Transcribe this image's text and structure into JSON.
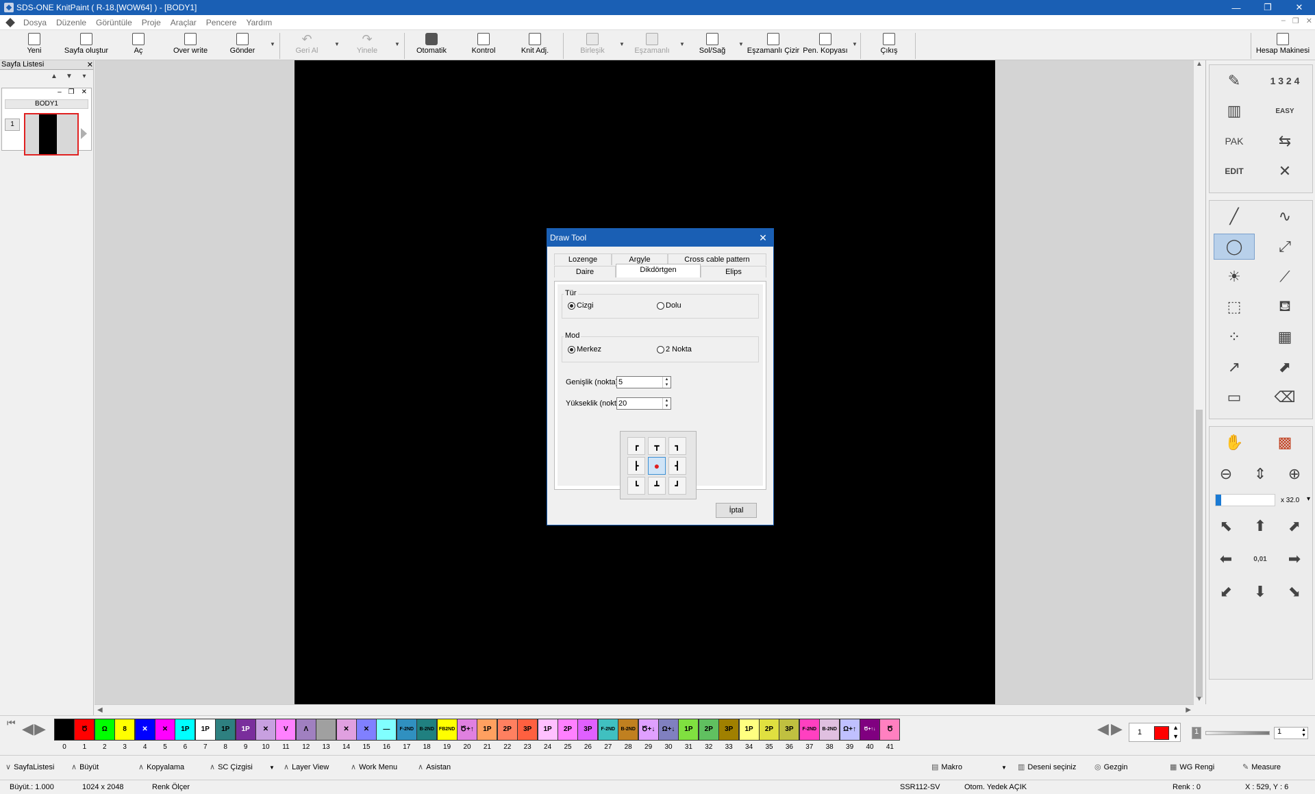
{
  "window": {
    "title": "SDS-ONE KnitPaint ( R-18.[WOW64] ) - [BODY1]",
    "minimize": "—",
    "restore": "❐",
    "close": "✕"
  },
  "menu": [
    "Dosya",
    "Düzenle",
    "Görüntüle",
    "Proje",
    "Araçlar",
    "Pencere",
    "Yardım"
  ],
  "mdi_controls": [
    "–",
    "❐",
    "✕"
  ],
  "toolbar": {
    "new": "Yeni",
    "create_page": "Sayfa oluştur",
    "open": "Aç",
    "overwrite": "Over write",
    "send": "Gönder",
    "undo": "Geri Al",
    "redo": "Yinele",
    "auto": "Otomatik",
    "control": "Kontrol",
    "knit_adj": "Knit Adj.",
    "merge": "Birleşik",
    "simultaneous": "Eşzamanlı",
    "left_right": "Sol/Sağ",
    "sync_draw": "Eşzamanlı Çizir",
    "pen_copy": "Pen. Kopyası",
    "exit": "Çıkış",
    "calculator": "Hesap Makinesi"
  },
  "page_list": {
    "title": "Sayfa Listesi",
    "close": "✕",
    "page_name": "BODY1",
    "page_number": "1"
  },
  "right_panel": {
    "zoom": "x 32.0",
    "easy": "EASY",
    "pak": "PAK",
    "edit": "EDIT",
    "step": "0,01",
    "numbers": "1 3 2 4"
  },
  "dialog": {
    "title": "Draw Tool",
    "close": "✕",
    "tabs_row1": [
      "Lozenge",
      "Argyle",
      "Cross cable pattern"
    ],
    "tabs_row2": [
      "Daire",
      "Dikdörtgen",
      "Elips"
    ],
    "active_tab": "Dikdörtgen",
    "type_group": {
      "label": "Tür",
      "options": [
        "Cizgi",
        "Dolu"
      ],
      "selected": "Cizgi"
    },
    "mode_group": {
      "label": "Mod",
      "options": [
        "Merkez",
        "2 Nokta"
      ],
      "selected": "Merkez"
    },
    "width_label": "Genişlik (nokta)",
    "width_value": "5",
    "height_label": "Yükseklik (nokta)",
    "height_value": "20",
    "anchor_selected": "center",
    "cancel": "İptal"
  },
  "palette": [
    {
      "n": "0",
      "c": "#000000",
      "t": ""
    },
    {
      "n": "1",
      "c": "#ff0000",
      "t": "Ծ"
    },
    {
      "n": "2",
      "c": "#00ff00",
      "t": "Ω"
    },
    {
      "n": "3",
      "c": "#ffff00",
      "t": "8"
    },
    {
      "n": "4",
      "c": "#0000ff",
      "t": "✕"
    },
    {
      "n": "5",
      "c": "#ff00ff",
      "t": "✕"
    },
    {
      "n": "6",
      "c": "#00ffff",
      "t": "1P"
    },
    {
      "n": "7",
      "c": "#ffffff",
      "t": "1P"
    },
    {
      "n": "8",
      "c": "#2e8080",
      "t": "1P"
    },
    {
      "n": "9",
      "c": "#7a2e9c",
      "t": "1P"
    },
    {
      "n": "10",
      "c": "#c8a0e0",
      "t": "✕"
    },
    {
      "n": "11",
      "c": "#ff80ff",
      "t": "V"
    },
    {
      "n": "12",
      "c": "#a080c0",
      "t": "Λ"
    },
    {
      "n": "13",
      "c": "#a0a0a0",
      "t": ""
    },
    {
      "n": "14",
      "c": "#e0a0e0",
      "t": "✕"
    },
    {
      "n": "15",
      "c": "#8080ff",
      "t": "✕"
    },
    {
      "n": "16",
      "c": "#80ffff",
      "t": "—"
    },
    {
      "n": "17",
      "c": "#3090c0",
      "t": "F-2ND"
    },
    {
      "n": "18",
      "c": "#208080",
      "t": "B-2ND"
    },
    {
      "n": "19",
      "c": "#ffff00",
      "t": "FB2ND"
    },
    {
      "n": "20",
      "c": "#e080e0",
      "t": "Ծ+↑"
    },
    {
      "n": "21",
      "c": "#ffa060",
      "t": "1P"
    },
    {
      "n": "22",
      "c": "#ff8060",
      "t": "2P"
    },
    {
      "n": "23",
      "c": "#ff6040",
      "t": "3P"
    },
    {
      "n": "24",
      "c": "#ffc0ff",
      "t": "1P"
    },
    {
      "n": "25",
      "c": "#ff80ff",
      "t": "2P"
    },
    {
      "n": "26",
      "c": "#e060ff",
      "t": "3P"
    },
    {
      "n": "27",
      "c": "#40c0c0",
      "t": "F-2ND"
    },
    {
      "n": "28",
      "c": "#c08020",
      "t": "B-2ND"
    },
    {
      "n": "29",
      "c": "#e0a0ff",
      "t": "Ծ+↓"
    },
    {
      "n": "30",
      "c": "#8080c0",
      "t": "Ω+↓"
    },
    {
      "n": "31",
      "c": "#80e040",
      "t": "1P"
    },
    {
      "n": "32",
      "c": "#60c060",
      "t": "2P"
    },
    {
      "n": "33",
      "c": "#a08000",
      "t": "3P"
    },
    {
      "n": "34",
      "c": "#ffff80",
      "t": "1P"
    },
    {
      "n": "35",
      "c": "#e0e040",
      "t": "2P"
    },
    {
      "n": "36",
      "c": "#c0c040",
      "t": "3P"
    },
    {
      "n": "37",
      "c": "#ff40c0",
      "t": "F-2ND"
    },
    {
      "n": "38",
      "c": "#e0c0e0",
      "t": "B-2ND"
    },
    {
      "n": "39",
      "c": "#c0c0ff",
      "t": "Ω+↑"
    },
    {
      "n": "40",
      "c": "#800080",
      "t": "Ծ+↑↓"
    },
    {
      "n": "41",
      "c": "#ff80c0",
      "t": "Ծ"
    }
  ],
  "palette_controls": {
    "color_index": "1",
    "current_color": "#ff0000",
    "value": "1",
    "zoom_index": "1"
  },
  "bottom_bar": {
    "page_list": "SayfaListesi",
    "enlarge": "Büyüt",
    "copy": "Kopyalama",
    "sc_line": "SC Çizgisi",
    "layer_view": "Layer View",
    "work_menu": "Work Menu",
    "assistant": "Asistan",
    "macro": "Makro",
    "select_pattern": "Deseni seçiniz",
    "navigator": "Gezgin",
    "wg_color": "WG Rengi",
    "measure": "Measure"
  },
  "status": {
    "zoom": "Büyüt.: 1.000",
    "size": "1024 x 2048",
    "color_meter": "Renk Ölçer",
    "machine": "SSR112-SV",
    "autobackup": "Otom. Yedek AÇIK",
    "color": "Renk :  0",
    "coords": "X : 529, Y :   6"
  }
}
